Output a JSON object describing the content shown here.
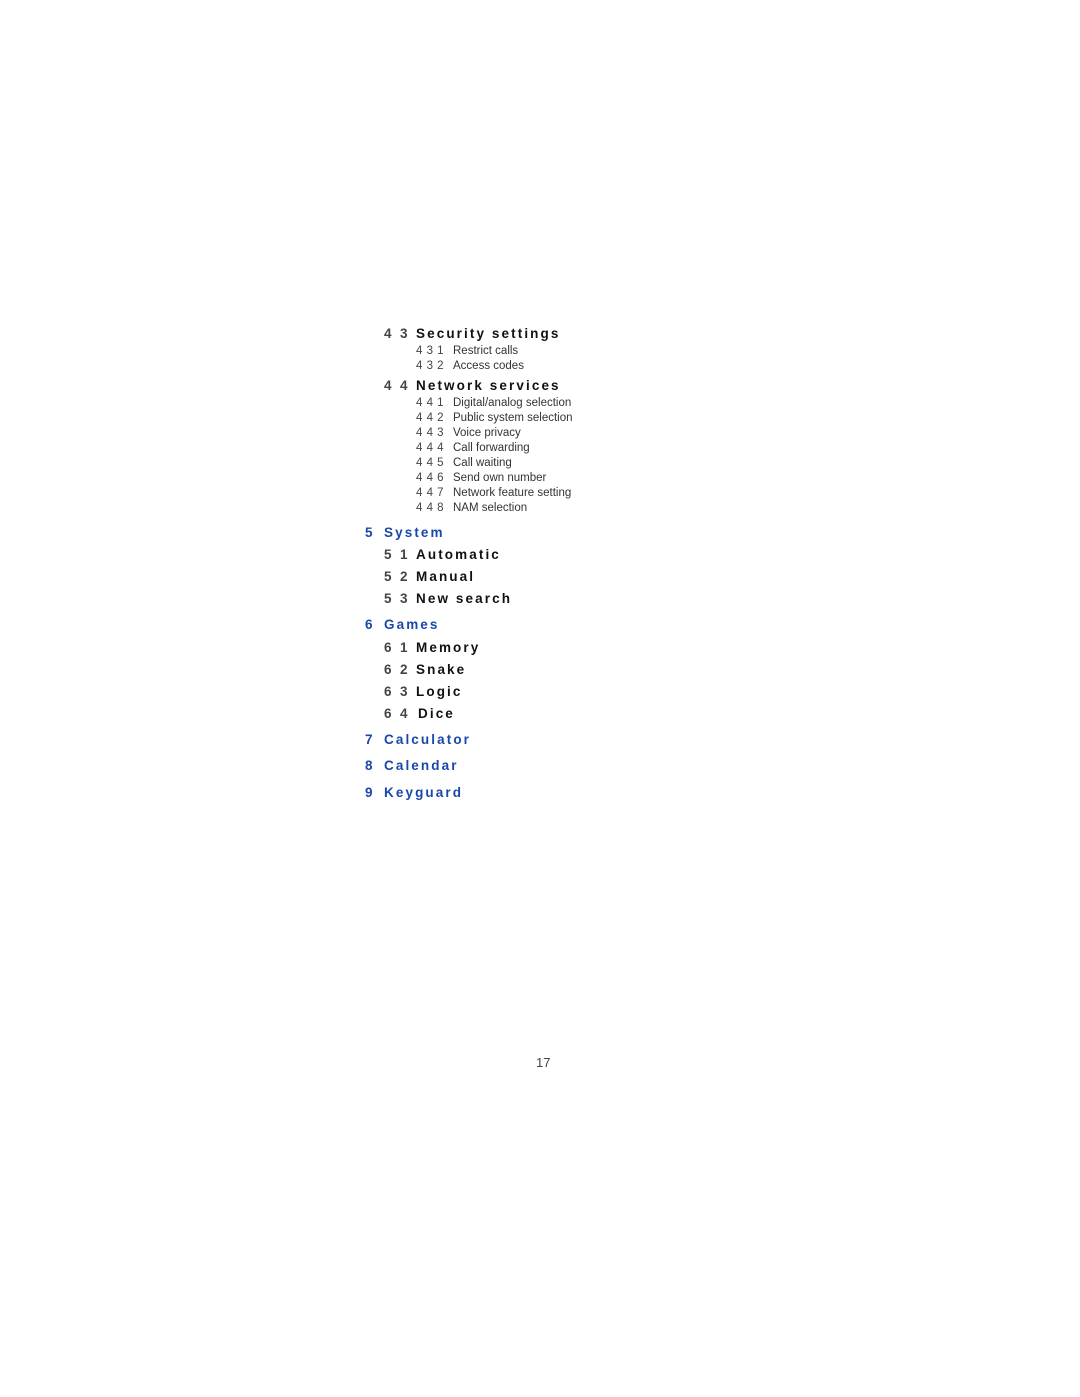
{
  "sections": [
    {
      "level": 2,
      "num": [
        "4",
        "3"
      ],
      "label": "Security settings",
      "items": [
        {
          "num": "4 3 1",
          "label": "Restrict calls"
        },
        {
          "num": "4 3 2",
          "label": "Access codes"
        }
      ]
    },
    {
      "level": 2,
      "num": [
        "4",
        "4"
      ],
      "label": "Network services",
      "items": [
        {
          "num": "4 4 1",
          "label": "Digital/analog selection"
        },
        {
          "num": "4 4 2",
          "label": "Public system selection"
        },
        {
          "num": "4 4 3",
          "label": "Voice privacy"
        },
        {
          "num": "4 4 4",
          "label": "Call forwarding"
        },
        {
          "num": "4 4 5",
          "label": "Call waiting"
        },
        {
          "num": "4 4 6",
          "label": "Send own number"
        },
        {
          "num": "4 4 7",
          "label": "Network feature setting"
        },
        {
          "num": "4 4 8",
          "label": "NAM selection"
        }
      ]
    }
  ],
  "system": {
    "num": "5",
    "label": "System",
    "items": [
      {
        "num": [
          "5",
          "1"
        ],
        "label": "Automatic"
      },
      {
        "num": [
          "5",
          "2"
        ],
        "label": "Manual"
      },
      {
        "num": [
          "5",
          "3"
        ],
        "label": "New search"
      }
    ]
  },
  "games": {
    "num": "6",
    "label": "Games",
    "items": [
      {
        "num": [
          "6",
          "1"
        ],
        "label": "Memory"
      },
      {
        "num": [
          "6",
          "2"
        ],
        "label": "Snake"
      },
      {
        "num": [
          "6",
          "3"
        ],
        "label": "Logic"
      },
      {
        "num": [
          "6",
          "4"
        ],
        "label": "Dice"
      }
    ]
  },
  "calculator": {
    "num": "7",
    "label": "Calculator"
  },
  "calendar": {
    "num": "8",
    "label": "Calendar"
  },
  "keyguard": {
    "num": "9",
    "label": "Keyguard"
  },
  "page_number": "17",
  "colors": {
    "accent": "#1a47a8",
    "text": "#111111"
  }
}
